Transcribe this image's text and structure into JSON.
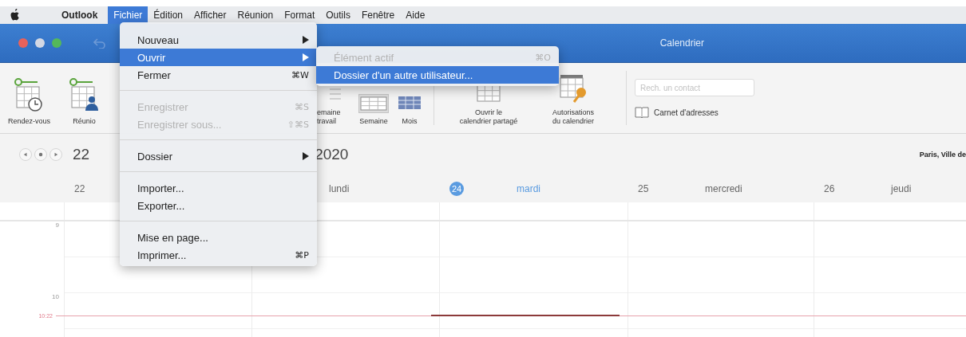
{
  "menu_bar": {
    "items": [
      {
        "label": "Outlook",
        "kind": "app",
        "selected": false
      },
      {
        "label": "Fichier",
        "kind": "menu",
        "selected": true
      },
      {
        "label": "Édition",
        "kind": "menu",
        "selected": false
      },
      {
        "label": "Afficher",
        "kind": "menu",
        "selected": false
      },
      {
        "label": "Réunion",
        "kind": "menu",
        "selected": false
      },
      {
        "label": "Format",
        "kind": "menu",
        "selected": false
      },
      {
        "label": "Outils",
        "kind": "menu",
        "selected": false
      },
      {
        "label": "Fenêtre",
        "kind": "menu",
        "selected": false
      },
      {
        "label": "Aide",
        "kind": "menu",
        "selected": false
      }
    ]
  },
  "window": {
    "title": "Calendrier"
  },
  "ribbon": {
    "buttons": [
      {
        "kind": "appointment",
        "lines": [
          "Rendez-vous"
        ],
        "selected": false
      },
      {
        "kind": "meeting",
        "lines": [
          "Réunio"
        ],
        "selected": false
      },
      {
        "kind": "workweek",
        "lines": [
          "emaine",
          "travail"
        ],
        "selected": false
      },
      {
        "kind": "week",
        "lines": [
          "Semaine"
        ],
        "selected": true
      },
      {
        "kind": "month",
        "lines": [
          "Mois"
        ],
        "selected": false
      },
      {
        "kind": "shared",
        "lines": [
          "Ouvrir le",
          "calendrier partagé"
        ],
        "selected": false
      },
      {
        "kind": "permissions",
        "lines": [
          "Autorisations",
          "du calendrier"
        ],
        "selected": false
      }
    ],
    "search": {
      "placeholder": "Rech. un contact"
    },
    "address_book": {
      "label": "Carnet d'adresses"
    }
  },
  "calendar": {
    "title_start": "22",
    "title_end": "2020",
    "location": "Paris, Ville de",
    "days": [
      {
        "number": "22",
        "today": false
      },
      {
        "name": "lundi",
        "today": false
      },
      {
        "number": "24",
        "name": "mardi",
        "today": true
      },
      {
        "number": "25",
        "name": "mercredi",
        "today": false
      },
      {
        "number": "26",
        "name": "jeudi",
        "today": false
      }
    ],
    "hours": [
      "9",
      "10"
    ],
    "current_time": "10:22"
  },
  "file_menu": {
    "items": [
      {
        "kind": "item",
        "label": "Nouveau",
        "has_submenu": true,
        "disabled": false,
        "selected": false
      },
      {
        "kind": "item",
        "label": "Ouvrir",
        "has_submenu": true,
        "disabled": false,
        "selected": true
      },
      {
        "kind": "item",
        "label": "Fermer",
        "shortcut": "⌘W",
        "has_submenu": false,
        "disabled": false,
        "selected": false
      },
      {
        "kind": "separator"
      },
      {
        "kind": "item",
        "label": "Enregistrer",
        "shortcut": "⌘S",
        "has_submenu": false,
        "disabled": true,
        "selected": false
      },
      {
        "kind": "item",
        "label": "Enregistrer sous...",
        "shortcut": "⇧⌘S",
        "has_submenu": false,
        "disabled": true,
        "selected": false
      },
      {
        "kind": "separator"
      },
      {
        "kind": "item",
        "label": "Dossier",
        "has_submenu": true,
        "disabled": false,
        "selected": false
      },
      {
        "kind": "separator"
      },
      {
        "kind": "item",
        "label": "Importer...",
        "has_submenu": false,
        "disabled": false,
        "selected": false
      },
      {
        "kind": "item",
        "label": "Exporter...",
        "has_submenu": false,
        "disabled": false,
        "selected": false
      },
      {
        "kind": "separator"
      },
      {
        "kind": "item",
        "label": "Mise en page...",
        "has_submenu": false,
        "disabled": false,
        "selected": false
      },
      {
        "kind": "item",
        "label": "Imprimer...",
        "shortcut": "⌘P",
        "has_submenu": false,
        "disabled": false,
        "selected": false
      }
    ]
  },
  "open_submenu": {
    "items": [
      {
        "kind": "item",
        "label": "Élément actif",
        "shortcut": "⌘O",
        "has_submenu": false,
        "disabled": true,
        "selected": false
      },
      {
        "kind": "item",
        "label": "Dossier d'un autre utilisateur...",
        "has_submenu": false,
        "disabled": false,
        "selected": true
      }
    ]
  }
}
